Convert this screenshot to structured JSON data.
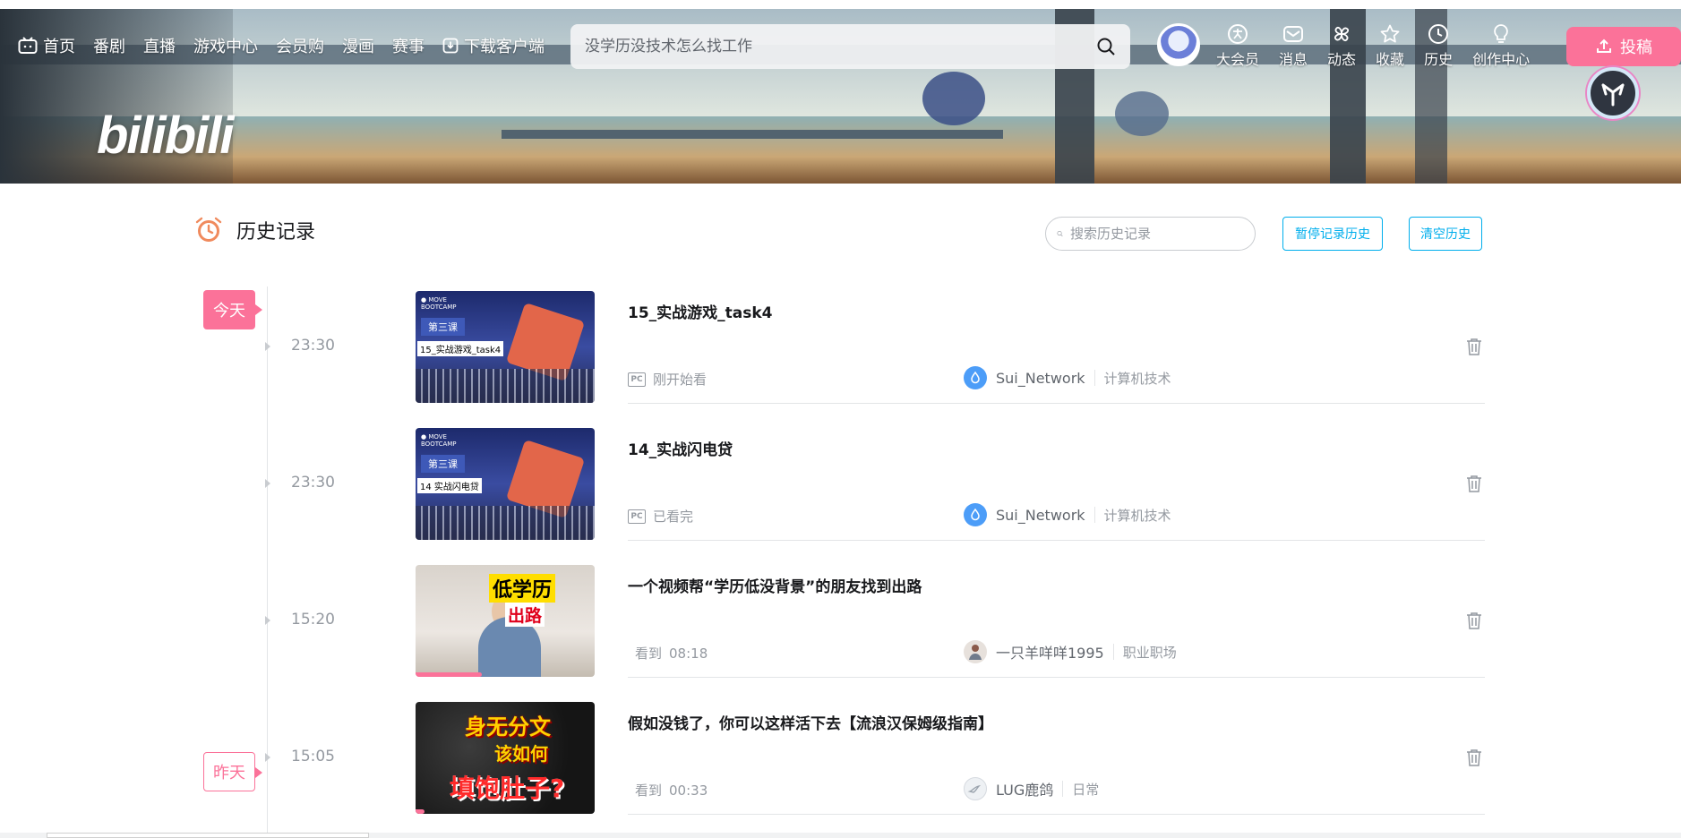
{
  "nav": {
    "items": [
      {
        "label": "首页",
        "icon": "tv-icon"
      },
      {
        "label": "番剧"
      },
      {
        "label": "直播"
      },
      {
        "label": "游戏中心"
      },
      {
        "label": "会员购"
      },
      {
        "label": "漫画"
      },
      {
        "label": "赛事"
      },
      {
        "label": "下载客户端",
        "icon": "download-icon"
      }
    ]
  },
  "search": {
    "placeholder": "没学历没技术怎么找工作"
  },
  "header_right": {
    "items": [
      {
        "label": "大会员",
        "icon": "vip-icon"
      },
      {
        "label": "消息",
        "icon": "mail-icon"
      },
      {
        "label": "动态",
        "icon": "pinwheel-icon"
      },
      {
        "label": "收藏",
        "icon": "star-icon"
      },
      {
        "label": "历史",
        "icon": "clock-icon"
      },
      {
        "label": "创作中心",
        "icon": "lightbulb-icon"
      }
    ],
    "upload_label": "投稿"
  },
  "logo_text": "bilibili",
  "history": {
    "title": "历史记录",
    "search_placeholder": "搜索历史记录",
    "pause_label": "暂停记录历史",
    "clear_label": "清空历史",
    "day_today": "今天",
    "day_yesterday": "昨天",
    "entries": [
      {
        "time": "23:30",
        "title": "15_实战游戏_task4",
        "progress_text": "刚开始看",
        "device": "PC",
        "author": "Sui_Network",
        "category": "计算机技术",
        "thumb_lesson": "第三课",
        "thumb_caption": "15_实战游戏_task4",
        "progress": 0
      },
      {
        "time": "23:30",
        "title": "14_实战闪电贷",
        "progress_text": "已看完",
        "device": "PC",
        "author": "Sui_Network",
        "category": "计算机技术",
        "thumb_lesson": "第三课",
        "thumb_caption": "14 实战闪电贷",
        "progress": 1.0
      },
      {
        "time": "15:20",
        "title": "一个视频帮“学历低没背景”的朋友找到出路",
        "progress_label": "看到",
        "progress_time": "08:18",
        "author": "一只羊咩咩1995",
        "category": "职业职场",
        "thumb_line1": "低学历",
        "thumb_line2": "出路",
        "progress": 0.37
      },
      {
        "time": "15:05",
        "title": "假如没钱了，你可以这样活下去【流浪汉保姆级指南】",
        "progress_label": "看到",
        "progress_time": "00:33",
        "author": "LUG鹿鸽",
        "category": "日常",
        "thumb_line1": "身无分文",
        "thumb_line2": "该如何",
        "thumb_line3": "填饱肚子?",
        "progress": 0.05
      }
    ]
  },
  "colors": {
    "brand_pink": "#fb7299",
    "link_blue": "#00aeec",
    "sui_blue": "#4c9df8"
  }
}
